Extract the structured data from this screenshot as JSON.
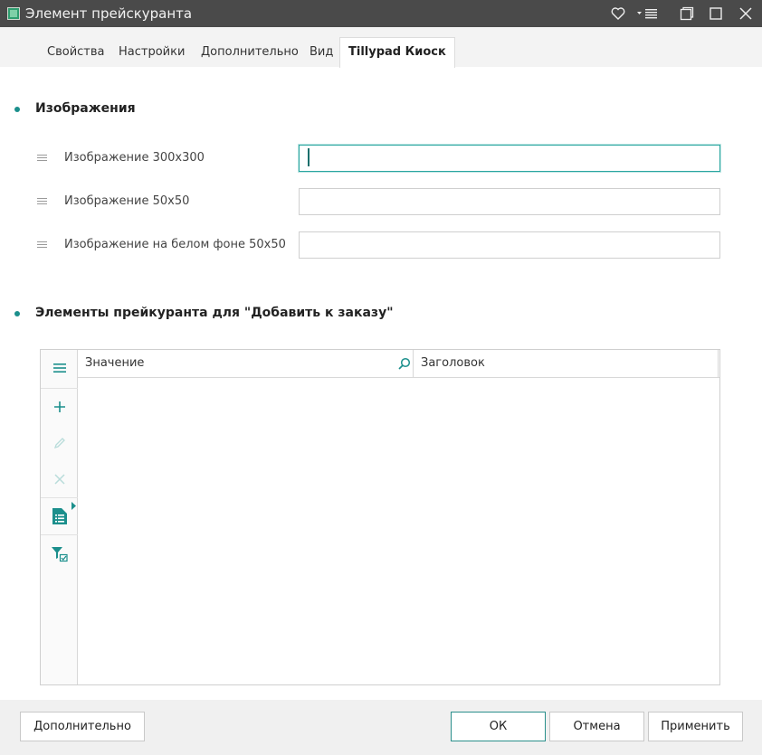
{
  "window": {
    "title": "Элемент прейскуранта"
  },
  "tabs": [
    {
      "label": "Свойства"
    },
    {
      "label": "Настройки"
    },
    {
      "label": "Дополнительно"
    },
    {
      "label": "Вид"
    },
    {
      "label": "Tillypad Киоск",
      "active": true
    }
  ],
  "images_section": {
    "title": "Изображения",
    "fields": [
      {
        "label": "Изображение 300x300",
        "value": ""
      },
      {
        "label": "Изображение 50x50",
        "value": ""
      },
      {
        "label": "Изображение на белом фоне 50x50",
        "value": ""
      }
    ]
  },
  "items_section": {
    "title": "Элементы прейкуранта для \"Добавить к заказу\"",
    "columns": [
      {
        "label": "Значение"
      },
      {
        "label": "Заголовок"
      }
    ],
    "rows": []
  },
  "footer": {
    "more_label": "Дополнительно",
    "ok_label": "ОК",
    "cancel_label": "Отмена",
    "apply_label": "Применить"
  },
  "colors": {
    "accent": "#1b8f8c",
    "titlebar": "#4a4a4a"
  }
}
